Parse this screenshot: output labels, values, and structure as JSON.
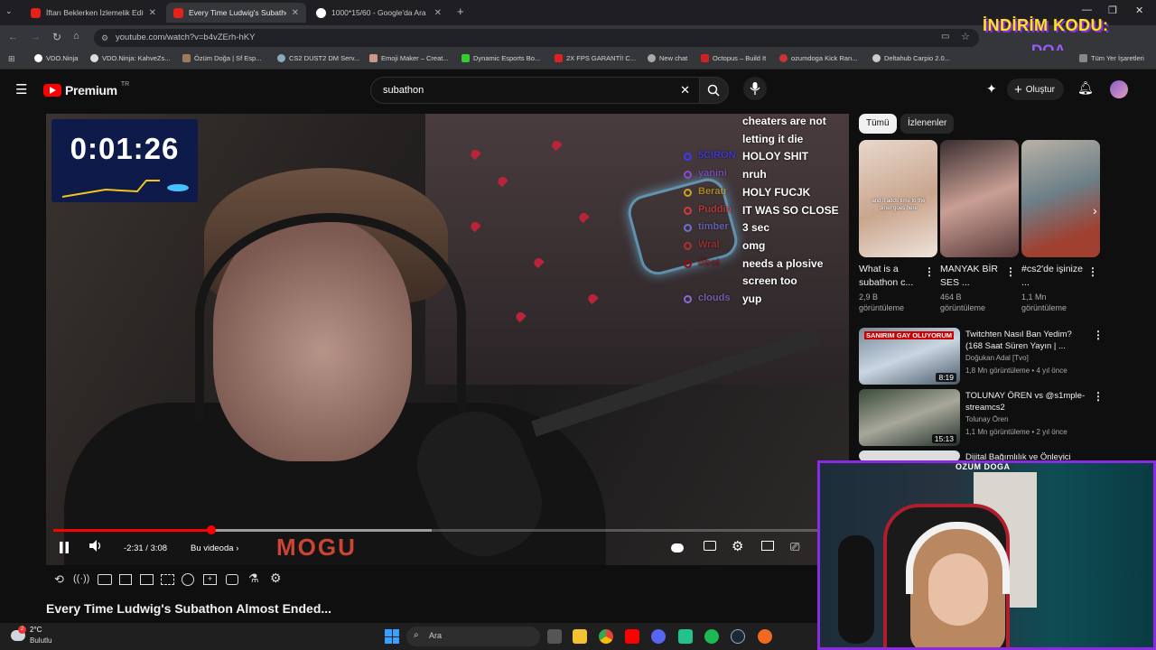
{
  "browser": {
    "tabs": [
      {
        "label": "İftarı Beklerken İzlemelik Edit",
        "active": false
      },
      {
        "label": "Every Time Ludwig's Subathon",
        "active": true
      },
      {
        "label": "1000*15/60 - Google'da Ara",
        "active": false
      }
    ],
    "url": "youtube.com/watch?v=b4vZErh-hKY",
    "bookmarks": [
      "VDO.Ninja",
      "VDO.Ninja: KahveZs...",
      "Özüm Doğa | Sf Esp...",
      "CS2 DUST2 DM Serv...",
      "Emoji Maker – Creat...",
      "Dynamic Esports Bo...",
      "2X FPS GARANTİ! C...",
      "New chat",
      "Octopus – Build It",
      "ozumdoga Kick Ran...",
      "Deltahub Carpio 2.0...",
      "Tüm Yer İşaretleri"
    ]
  },
  "overlay_promo": {
    "line1": "İNDİRİM KODU:",
    "line2": "DOA"
  },
  "youtube": {
    "logo": "Premium",
    "logo_region": "TR",
    "search_value": "subathon",
    "create_label": "Oluştur"
  },
  "player": {
    "timer": "0:01:26",
    "time_display": "-2:31 / 3:08",
    "chapter_label": "Bu videoda",
    "progress_fraction": 0.2,
    "buffered_fraction": 0.48,
    "chat": [
      {
        "user": "",
        "message": "cheaters are not",
        "color": "#ffffff"
      },
      {
        "user": "",
        "message": "letting it die",
        "color": "#ffffff"
      },
      {
        "user": "5CIRON",
        "message": "HOLOY SHIT",
        "color": "#3a3aff"
      },
      {
        "user": "yanini",
        "message": "nruh",
        "color": "#8a4fd0"
      },
      {
        "user": "Berau",
        "message": "HOLY FUCJK",
        "color": "#d0a020"
      },
      {
        "user": "Puddin",
        "message": "IT WAS SO CLOSE",
        "color": "#d63a3a"
      },
      {
        "user": "timber",
        "message": "3 sec",
        "color": "#6f6fd0"
      },
      {
        "user": "Wral",
        "message": "omg",
        "color": "#b03030"
      },
      {
        "user": "dbot",
        "message": "needs a plosive",
        "color": "#8a1010"
      },
      {
        "user": "",
        "message": "screen too",
        "color": "#ffffff"
      },
      {
        "user": "clouds",
        "message": "yup",
        "color": "#8a6bd0"
      }
    ]
  },
  "video_title": "Every Time Ludwig's Subathon Almost Ended...",
  "sidebar": {
    "chips": [
      "Tümü",
      "İzlenenler"
    ],
    "shorts": [
      {
        "title": "What is a subathon c...",
        "views": "2,9 B görüntüleme",
        "caption": "and it adds time to the timer goes here"
      },
      {
        "title": "MANYAK BİR SES ...",
        "views": "464 B görüntüleme"
      },
      {
        "title": "#cs2'de işinize ...",
        "views": "1,1 Mn görüntüleme"
      }
    ],
    "videos": [
      {
        "title": "Twitchten Nasıl Ban Yedim? (168 Saat Süren Yayın | ...",
        "channel": "Doğukan Adal [Tvo]",
        "meta": "1,8 Mn görüntüleme • 4 yıl önce",
        "duration": "8:19",
        "thumb_text": "SANIRIM GAY OLUYORUM"
      },
      {
        "title": "TOLUNAY ÖREN vs @s1mple-streamcs2",
        "channel": "Tolunay Ören",
        "meta": "1,1 Mn görüntüleme • 2 yıl önce",
        "duration": "15:13"
      },
      {
        "title": "Dijital Bağımlılık ve Önleyici",
        "channel": "",
        "meta": "",
        "duration": ""
      }
    ]
  },
  "webcam": {
    "label": "ÖZÜM DOĞA"
  },
  "taskbar": {
    "weather_temp": "2°C",
    "weather_desc": "Bulutlu",
    "search_label": "Ara",
    "badge": "2"
  },
  "colors": {
    "accent": "#ff0000",
    "webcam_border": "#8a2be2",
    "promo": "#ffe21a"
  }
}
